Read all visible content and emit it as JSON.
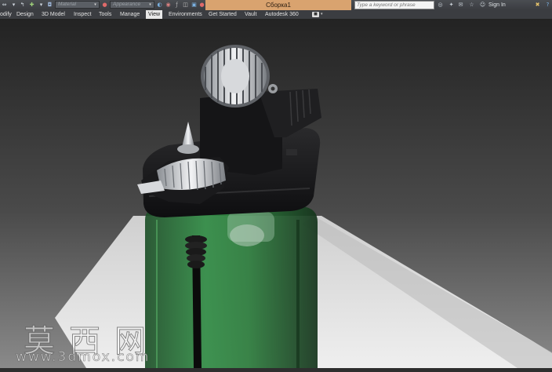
{
  "titlebar": {
    "material_combo": "Material",
    "appearance_combo": "Appearance",
    "document_title": "Сборка1",
    "search_placeholder": "Type a keyword or phrase",
    "sign_in": "Sign In",
    "combo_arrow": "▾"
  },
  "ribbon": {
    "tabs": [
      "odify",
      "Design",
      "3D Model",
      "Inspect",
      "Tools",
      "Manage",
      "View",
      "Environments",
      "Get Started",
      "Vault",
      "Autodesk 360"
    ],
    "active_tab": "View",
    "extra_arrow": "▾"
  },
  "watermark": {
    "chinese": "莫西网",
    "url": "www.3dmox.com"
  },
  "colors": {
    "document_tab": "#d9a36f",
    "lighter_body": "#2f7a3c",
    "lighter_head": "#1c1c1e",
    "metal": "#c9ccd0"
  }
}
